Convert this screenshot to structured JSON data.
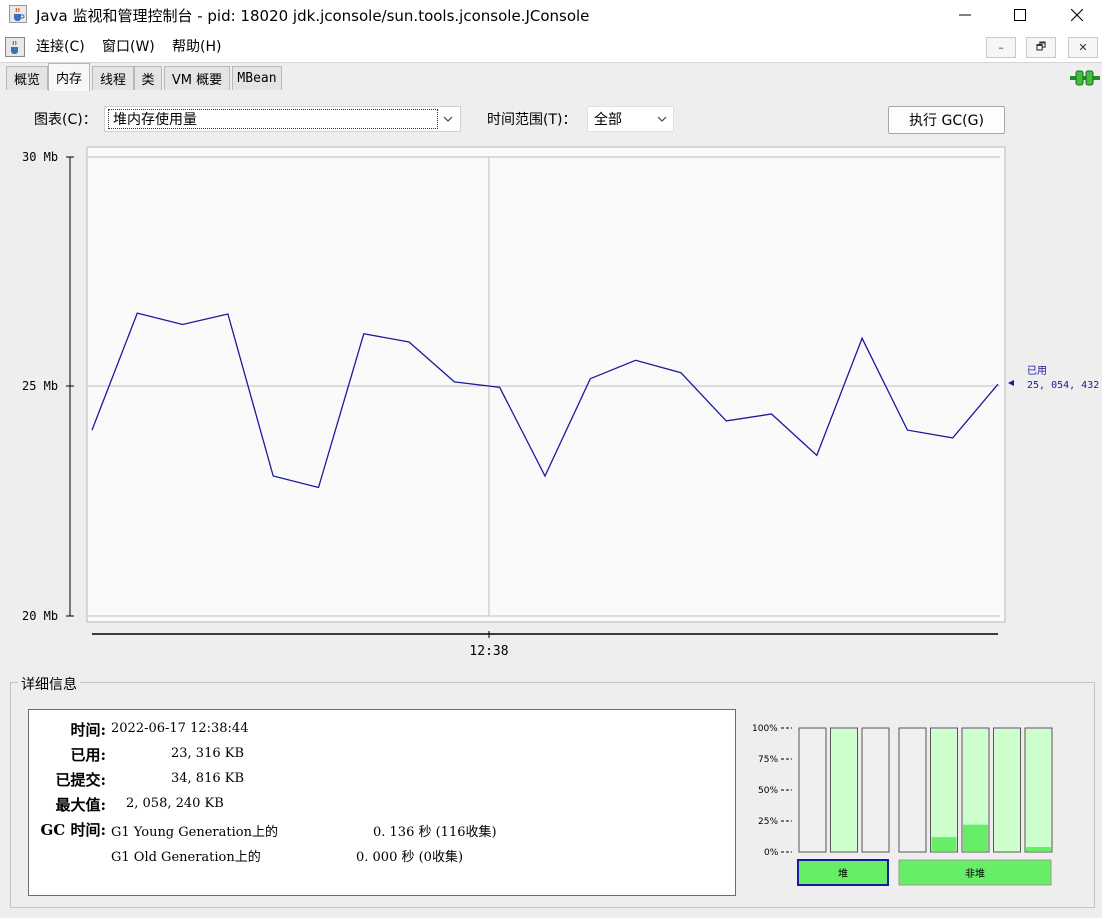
{
  "window": {
    "title": "Java 监视和管理控制台 - pid: 18020 jdk.jconsole/sun.tools.jconsole.JConsole",
    "minimize_glyph": "—",
    "maximize_glyph": "☐",
    "close_glyph": "✕"
  },
  "menu": {
    "items": [
      "连接(C)",
      "窗口(W)",
      "帮助(H)"
    ],
    "inner_controls": [
      "–",
      "🗗",
      "✕"
    ]
  },
  "tabs": [
    {
      "label": "概览",
      "active": false
    },
    {
      "label": "内存",
      "active": true
    },
    {
      "label": "线程",
      "active": false
    },
    {
      "label": "类",
      "active": false
    },
    {
      "label": "VM 概要",
      "active": false
    },
    {
      "label": "MBean",
      "active": false
    }
  ],
  "toolbar": {
    "chart_label": "图表(C)：",
    "chart_selected": "堆内存使用量",
    "range_label": "时间范围(T)：",
    "range_selected": "全部",
    "gc_button": "执行 GC(G)"
  },
  "chart_data": {
    "type": "line",
    "y_ticks": [
      "30 Mb",
      "25 Mb",
      "20 Mb"
    ],
    "ylim": [
      20,
      30
    ],
    "x_tick": "12:38",
    "series": [
      {
        "name": "已用",
        "color": "#1a1a9c",
        "values": [
          24.05,
          26.6,
          26.35,
          26.58,
          23.05,
          22.8,
          26.15,
          25.97,
          25.1,
          24.98,
          23.05,
          25.17,
          25.57,
          25.3,
          24.25,
          24.4,
          23.5,
          26.05,
          24.05,
          23.88,
          25.05
        ]
      }
    ],
    "current_label": "已用",
    "current_value": "25, 054, 432",
    "grid": true
  },
  "details": {
    "title": "详细信息",
    "time_label": "时间:",
    "time_value": "2022-06-17 12:38:44",
    "used_label": "已用:",
    "used_value": "23, 316 KB",
    "committed_label": "已提交:",
    "committed_value": "34, 816 KB",
    "max_label": "最大值:",
    "max_value": "2, 058, 240 KB",
    "gc_label": "GC 时间:",
    "gc": [
      {
        "name": "G1 Young Generation上的",
        "time": "0. 136 秒 (116收集)"
      },
      {
        "name": "G1 Old Generation上的",
        "time": "0. 000 秒 (0收集)"
      }
    ]
  },
  "pools": {
    "axis_labels": [
      "100%",
      "75%",
      "50%",
      "25%",
      "0%"
    ],
    "heap_label": "堆",
    "nonheap_label": "非堆",
    "heap": [
      {
        "committed": 0,
        "used": 0
      },
      {
        "committed": 1.0,
        "used": 0
      },
      {
        "committed": 0,
        "used": 0
      }
    ],
    "nonheap": [
      {
        "committed": 0,
        "used": 0
      },
      {
        "committed": 1.0,
        "used": 0.12
      },
      {
        "committed": 1.0,
        "used": 0.22
      },
      {
        "committed": 1.0,
        "used": 0
      },
      {
        "committed": 1.0,
        "used": 0.04
      }
    ],
    "colors": {
      "committed": "#ccffcc",
      "used": "#66ee66",
      "empty": "#f0f0f0",
      "selected_border": "#1a1a9c"
    }
  }
}
